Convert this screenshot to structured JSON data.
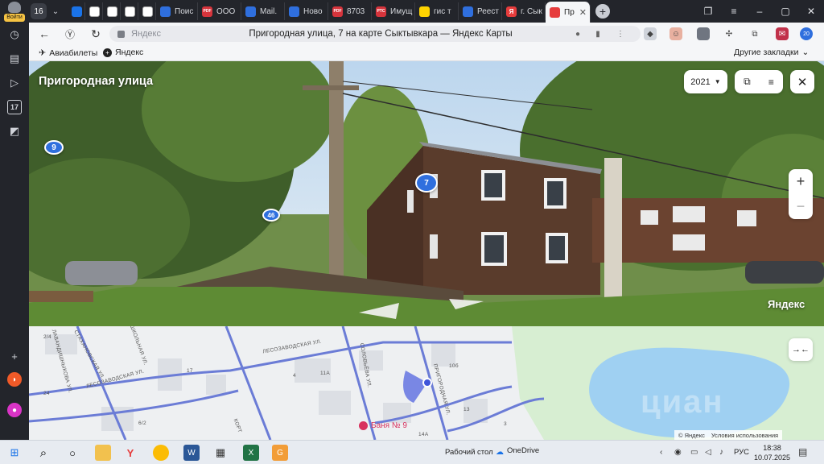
{
  "browser": {
    "login_label": "Войти",
    "tab_count": "16",
    "tabs": [
      {
        "label": "",
        "color": "#1a73e8"
      },
      {
        "label": "",
        "color": "#ffffff"
      },
      {
        "label": "",
        "color": "#ffffff"
      },
      {
        "label": "",
        "color": "#ffffff"
      },
      {
        "label": "",
        "color": "#ffffff"
      },
      {
        "label": "Поис",
        "color": "#2f6fde"
      },
      {
        "label": "ООО",
        "color": "#d6343c"
      },
      {
        "label": "Mail.",
        "color": "#2f6fde"
      },
      {
        "label": "Ново",
        "color": "#2f6fde"
      },
      {
        "label": "8703",
        "color": "#d6343c"
      },
      {
        "label": "Имущ",
        "color": "#d6343c"
      },
      {
        "label": "гис т",
        "color": "#ffd400"
      },
      {
        "label": "Реест",
        "color": "#2f6fde"
      },
      {
        "label": "г. Сык",
        "color": "#e63c3c"
      },
      {
        "label": "Пр",
        "color": "#e63c3c",
        "active": true
      }
    ],
    "fav_texts": {
      "pdf": "PDF",
      "rtc": "РТС",
      "ya": "Я"
    },
    "url_domain": "Яндекс",
    "page_title": "Пригородная улица, 7 на карте Сыктывкара — Яндекс Карты",
    "extension_badge": "20",
    "bookmarks": [
      {
        "label": "Авиабилеты",
        "icon": "plane-icon"
      },
      {
        "label": "Яндекс",
        "icon": "yandex-icon"
      }
    ],
    "other_bookmarks": "Другие закладки"
  },
  "panorama": {
    "street_title": "Пригородная улица",
    "year": "2021",
    "house_badges": [
      "9",
      "46",
      "7"
    ],
    "watermark": "Яндекс"
  },
  "minimap": {
    "streets": [
      "ЛЕСОЗАВОДСКАЯ УЛ.",
      "СОЛОВЬЁВА УЛ.",
      "ЛЕСОЗАВОДСКАЯ УЛ.",
      "СТАХАНОВСКАЯ УЛ.",
      "ШКОЛЬНАЯ УЛ.",
      "ЛАВАНДИШНЫКОВА УЛ.",
      "КОРТ",
      "ПРИГОРОДНАЯ УЛ."
    ],
    "house_numbers": [
      "2/4",
      "17",
      "4",
      "11А",
      "10б",
      "24",
      "13",
      "14А",
      "6/2",
      "3"
    ],
    "poi": "Баня № 9",
    "copyright": "© Яндекс",
    "terms": "Условия использования",
    "cian_watermark": "циан"
  },
  "taskbar": {
    "desktop_label": "Рабочий стол",
    "onedrive_label": "OneDrive",
    "lang": "РУС",
    "time": "18:38",
    "date": "10.07.2025"
  }
}
